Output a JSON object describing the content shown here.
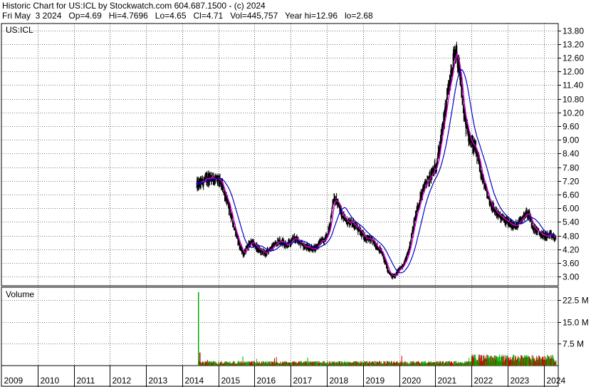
{
  "header": {
    "line1": "Historic Chart for US:ICL by Stockwatch.com 604.687.1500 - (c) 2024",
    "line2": "Fri May  3 2024   Op=4.69   Hi=4.7696   Lo=4.65   Cl=4.71   Vol=445,757   Year hi=12.96   lo=2.68"
  },
  "chart_data": [
    {
      "type": "line",
      "title": "US:ICL",
      "y_ticks": [
        "13.80",
        "13.20",
        "12.60",
        "12.00",
        "11.40",
        "10.80",
        "10.20",
        "9.60",
        "9.00",
        "8.40",
        "7.80",
        "7.20",
        "6.60",
        "6.00",
        "5.40",
        "4.80",
        "4.20",
        "3.60",
        "3.00"
      ],
      "ylim": [
        2.6,
        14.1
      ],
      "x_ticks": [
        "2009",
        "2010",
        "2011",
        "2012",
        "2013",
        "2014",
        "2015",
        "2016",
        "2017",
        "2018",
        "2019",
        "2020",
        "2021",
        "2022",
        "2023",
        "2024"
      ],
      "xlim": [
        2009.0,
        2024.4
      ],
      "series": [
        {
          "x": [
            2014.4,
            2014.5,
            2014.6,
            2014.7,
            2014.8,
            2014.9,
            2015.0,
            2015.1,
            2015.2,
            2015.3,
            2015.4,
            2015.5,
            2015.6,
            2015.7,
            2015.8,
            2015.9,
            2016.0,
            2016.1,
            2016.2,
            2016.3,
            2016.4,
            2016.5,
            2016.6,
            2016.7,
            2016.8,
            2016.9,
            2017.0,
            2017.1,
            2017.2,
            2017.3,
            2017.4,
            2017.5,
            2017.6,
            2017.7,
            2017.8,
            2017.9,
            2018.0,
            2018.1,
            2018.15,
            2018.2,
            2018.3,
            2018.4,
            2018.5,
            2018.6,
            2018.7,
            2018.8,
            2018.9,
            2019.0,
            2019.1,
            2019.2,
            2019.3,
            2019.4,
            2019.5,
            2019.6,
            2019.7,
            2019.8,
            2019.9,
            2020.0,
            2020.1,
            2020.2,
            2020.3,
            2020.4,
            2020.5,
            2020.6,
            2020.7,
            2020.8,
            2020.9,
            2021.0,
            2021.1,
            2021.2,
            2021.3,
            2021.4,
            2021.5,
            2021.6,
            2021.7,
            2021.8,
            2021.9,
            2022.0,
            2022.1,
            2022.2,
            2022.3,
            2022.4,
            2022.5,
            2022.6,
            2022.7,
            2022.8,
            2022.9,
            2023.0,
            2023.1,
            2023.2,
            2023.3,
            2023.4,
            2023.5,
            2023.6,
            2023.7,
            2023.8,
            2023.9,
            2024.0,
            2024.1,
            2024.2,
            2024.3,
            2024.34
          ],
          "values": [
            7.0,
            7.1,
            7.2,
            7.3,
            7.4,
            7.3,
            7.2,
            7.0,
            6.5,
            6.0,
            5.4,
            4.8,
            4.3,
            4.0,
            4.3,
            4.5,
            4.4,
            4.2,
            4.1,
            4.0,
            4.2,
            4.3,
            4.5,
            4.6,
            4.5,
            4.4,
            4.5,
            4.7,
            4.6,
            4.4,
            4.3,
            4.3,
            4.2,
            4.3,
            4.5,
            4.6,
            4.8,
            5.3,
            6.2,
            6.5,
            6.2,
            5.8,
            5.5,
            5.4,
            5.4,
            5.2,
            5.0,
            4.8,
            4.7,
            4.6,
            4.5,
            4.3,
            4.1,
            3.7,
            3.2,
            3.0,
            3.1,
            3.3,
            3.5,
            3.8,
            4.4,
            5.3,
            6.0,
            6.5,
            7.0,
            7.2,
            7.5,
            7.8,
            8.5,
            9.5,
            10.5,
            11.5,
            12.5,
            12.7,
            11.5,
            10.0,
            9.3,
            8.9,
            8.6,
            8.0,
            7.3,
            6.8,
            6.3,
            6.0,
            5.8,
            5.6,
            5.5,
            5.4,
            5.3,
            5.2,
            5.4,
            5.6,
            5.8,
            5.7,
            5.2,
            5.0,
            4.9,
            4.8,
            4.8,
            4.8,
            4.7,
            4.71
          ]
        }
      ]
    },
    {
      "type": "bar",
      "title": "Volume",
      "y_ticks": [
        "22.5 M",
        "15.0 M",
        "7.5 M"
      ],
      "ylim": [
        0,
        27
      ],
      "xlim": [
        2009.0,
        2024.4
      ],
      "spike": {
        "x": 2014.45,
        "value": 25.3
      },
      "baseline_range": [
        2014.45,
        2024.34
      ],
      "baseline_level": 1.0,
      "elevated_range": [
        2022.0,
        2024.34
      ],
      "elevated_level": 2.4
    }
  ],
  "colors": {
    "price": "#000000",
    "ma_short": "#cc00cc",
    "ma_long": "#0000cc",
    "vol_up": "#00aa00",
    "vol_down": "#cc0000",
    "grid": "#000000"
  }
}
